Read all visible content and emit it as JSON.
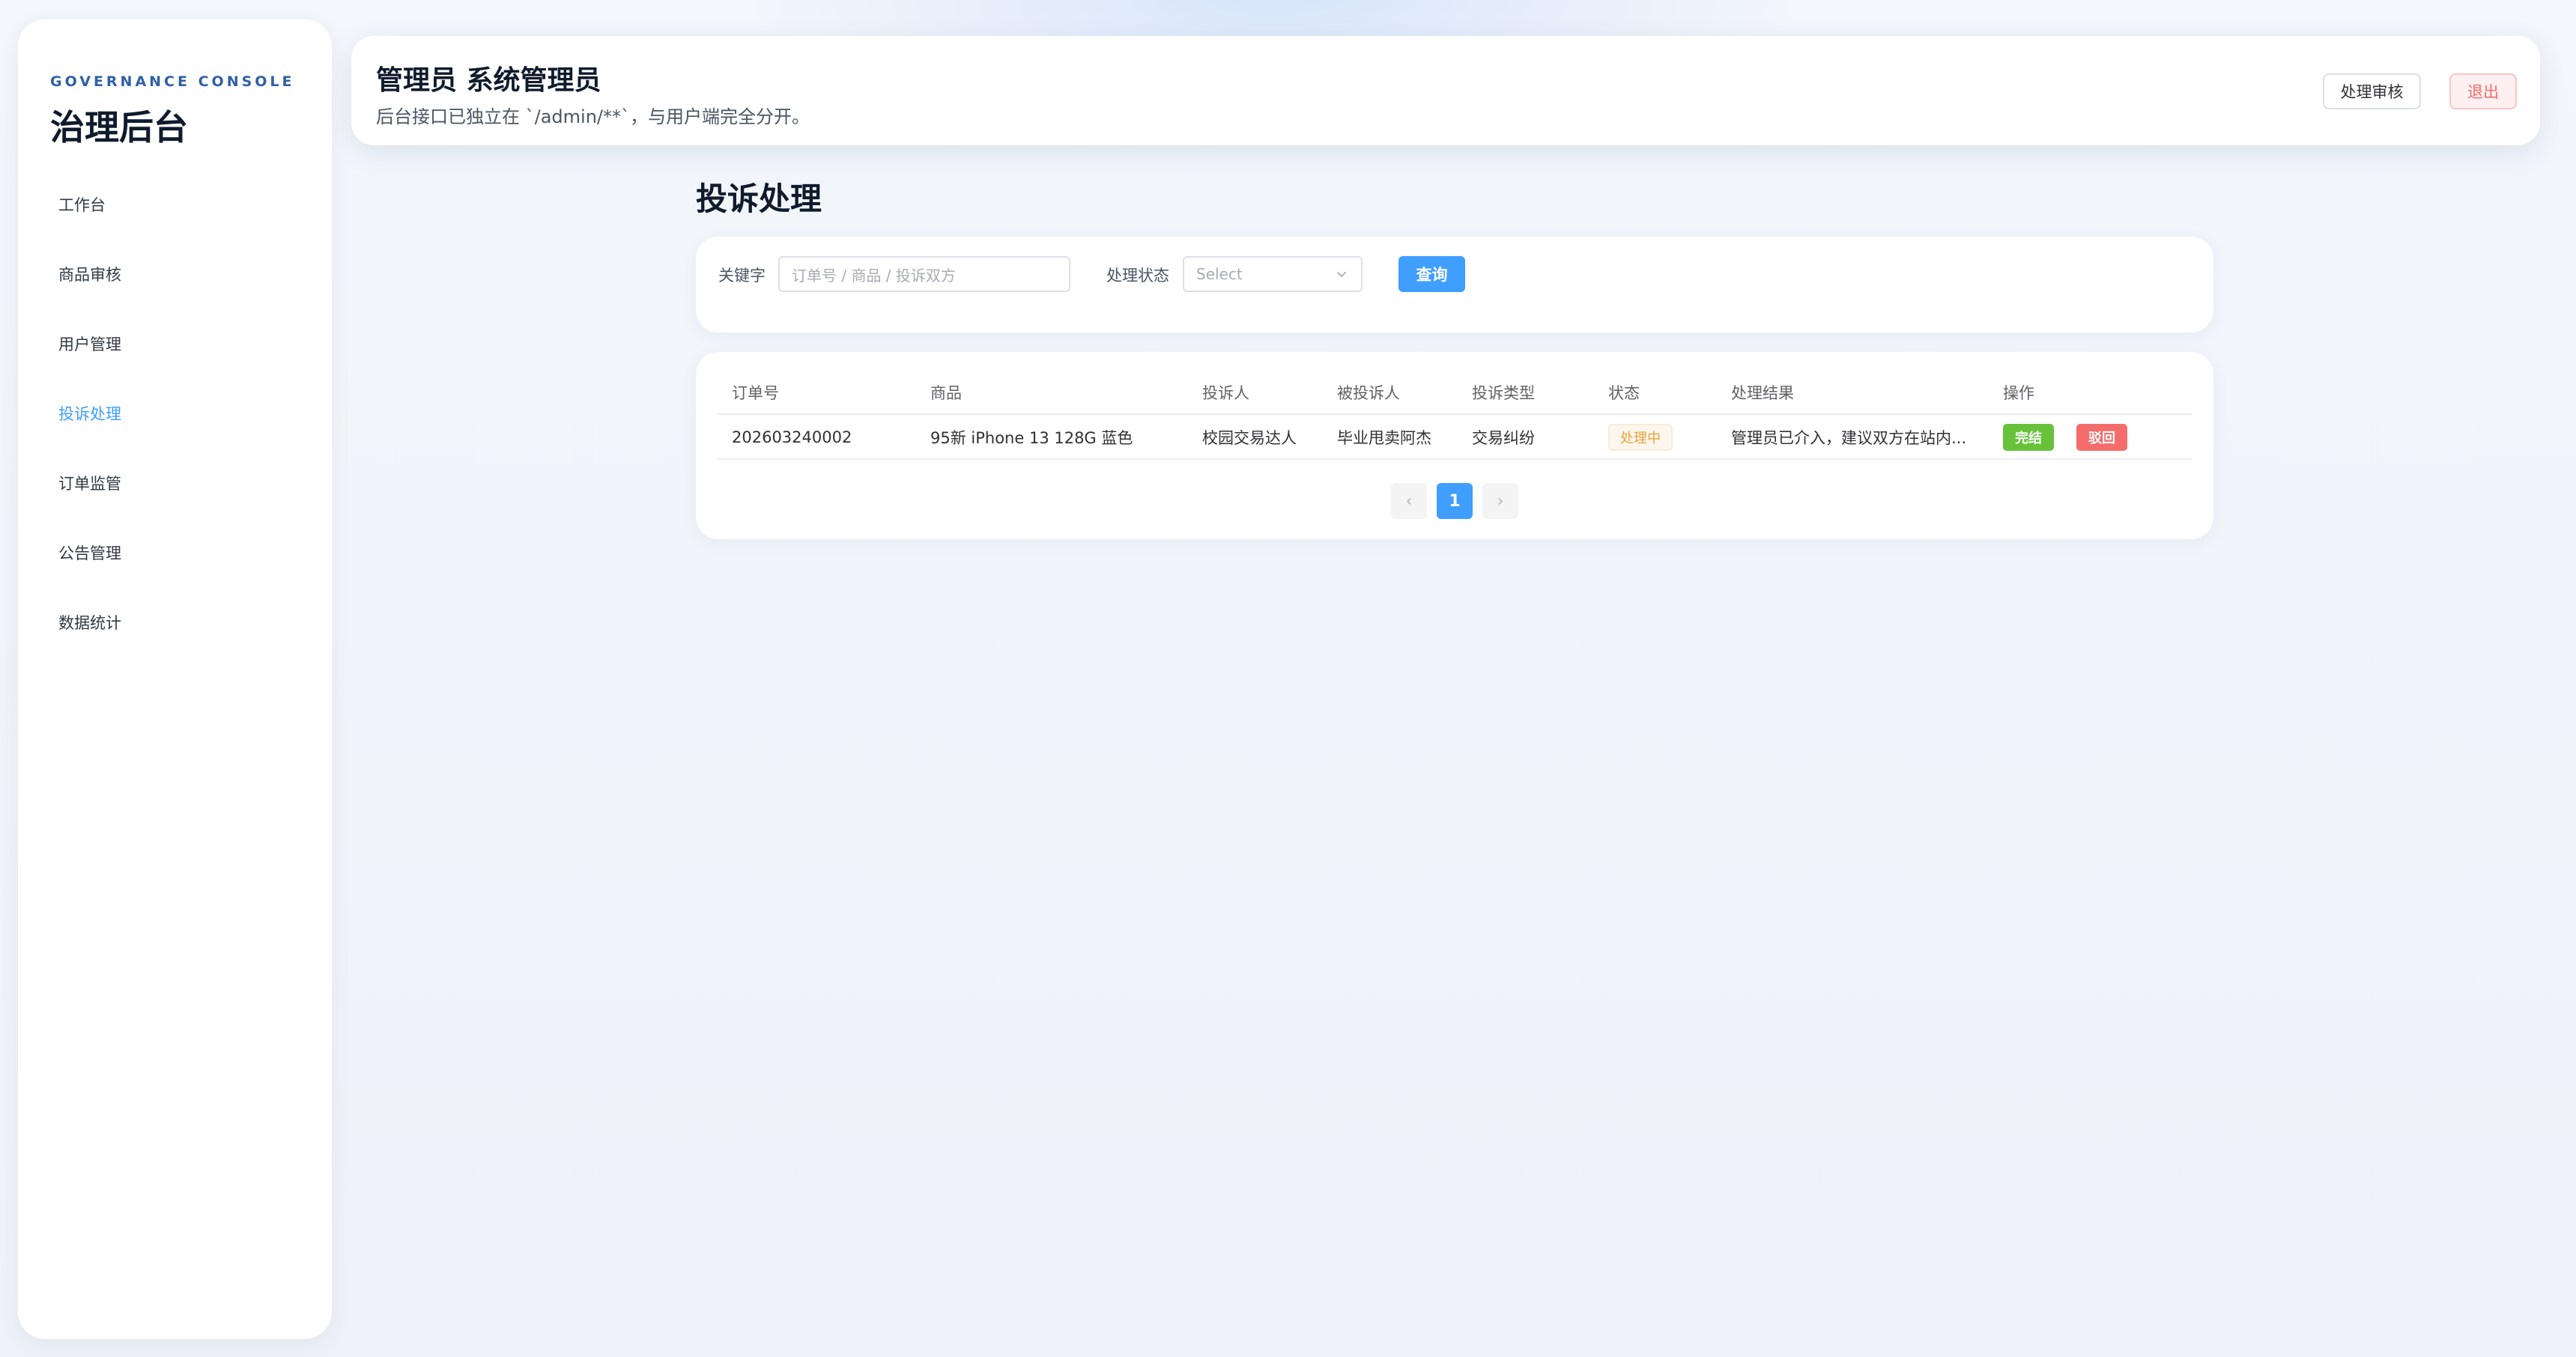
{
  "sidebar": {
    "eyebrow": "GOVERNANCE CONSOLE",
    "title": "治理后台",
    "items": [
      {
        "label": "工作台",
        "active": false
      },
      {
        "label": "商品审核",
        "active": false
      },
      {
        "label": "用户管理",
        "active": false
      },
      {
        "label": "投诉处理",
        "active": true
      },
      {
        "label": "订单监管",
        "active": false
      },
      {
        "label": "公告管理",
        "active": false
      },
      {
        "label": "数据统计",
        "active": false
      }
    ]
  },
  "header": {
    "title": "管理员 系统管理员",
    "subtitle": "后台接口已独立在 `/admin/**`，与用户端完全分开。",
    "review_label": "处理审核",
    "logout_label": "退出"
  },
  "page": {
    "title": "投诉处理"
  },
  "filter": {
    "keyword_label": "关键字",
    "keyword_placeholder": "订单号 / 商品 / 投诉双方",
    "keyword_value": "",
    "status_label": "处理状态",
    "status_placeholder": "Select",
    "query_label": "查询"
  },
  "table": {
    "columns": [
      "订单号",
      "商品",
      "投诉人",
      "被投诉人",
      "投诉类型",
      "状态",
      "处理结果",
      "操作"
    ],
    "rows": [
      {
        "order_no": "202603240002",
        "product": "95新 iPhone 13 128G 蓝色",
        "complainant": "校园交易达人",
        "respondent": "毕业甩卖阿杰",
        "type": "交易纠纷",
        "status": "处理中",
        "result": "管理员已介入，建议双方在站内...",
        "action_done": "完结",
        "action_reject": "驳回"
      }
    ]
  },
  "pagination": {
    "prev": "‹",
    "current": "1",
    "next": "›"
  },
  "colors": {
    "accent": "#409eff",
    "success": "#67c23a",
    "danger": "#f56c6c",
    "warning": "#e6a23c",
    "brand_eyebrow": "#2f5fa8"
  }
}
